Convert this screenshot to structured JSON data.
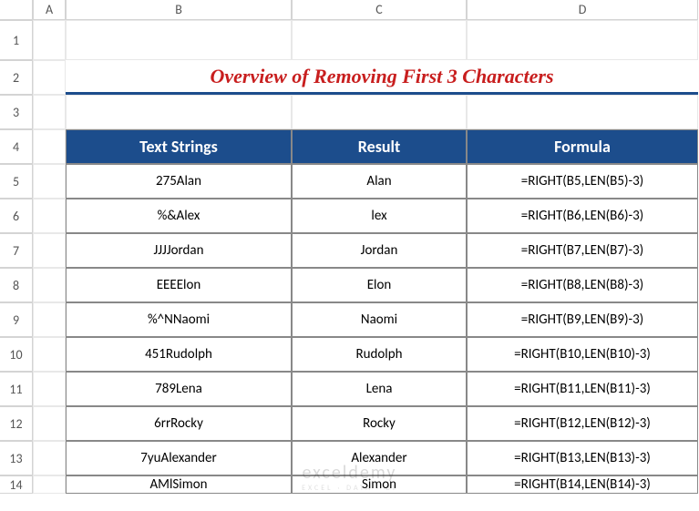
{
  "columns": [
    "A",
    "B",
    "C",
    "D"
  ],
  "rows": [
    "1",
    "2",
    "3",
    "4",
    "5",
    "6",
    "7",
    "8",
    "9",
    "10",
    "11",
    "12",
    "13",
    "14"
  ],
  "title": "Overview of Removing First 3 Characters",
  "headers": {
    "text_strings": "Text Strings",
    "result": "Result",
    "formula": "Formula"
  },
  "data": [
    {
      "text": "275Alan",
      "result": "Alan",
      "formula": "=RIGHT(B5,LEN(B5)-3)"
    },
    {
      "text": "%&Alex",
      "result": "lex",
      "formula": "=RIGHT(B6,LEN(B6)-3)"
    },
    {
      "text": "JJJJordan",
      "result": "Jordan",
      "formula": "=RIGHT(B7,LEN(B7)-3)"
    },
    {
      "text": "EEEElon",
      "result": "Elon",
      "formula": "=RIGHT(B8,LEN(B8)-3)"
    },
    {
      "text": "%^NNaomi",
      "result": "Naomi",
      "formula": "=RIGHT(B9,LEN(B9)-3)"
    },
    {
      "text": "451Rudolph",
      "result": "Rudolph",
      "formula": "=RIGHT(B10,LEN(B10)-3)"
    },
    {
      "text": "789Lena",
      "result": "Lena",
      "formula": "=RIGHT(B11,LEN(B11)-3)"
    },
    {
      "text": "6rrRocky",
      "result": "Rocky",
      "formula": "=RIGHT(B12,LEN(B12)-3)"
    },
    {
      "text": "7yuAlexander",
      "result": "Alexander",
      "formula": "=RIGHT(B13,LEN(B13)-3)"
    },
    {
      "text": "AMlSimon",
      "result": "Simon",
      "formula": "=RIGHT(B14,LEN(B14)-3)"
    }
  ],
  "watermark": {
    "title": "exceldemy",
    "subtitle": "EXCEL · DATA · BI"
  }
}
